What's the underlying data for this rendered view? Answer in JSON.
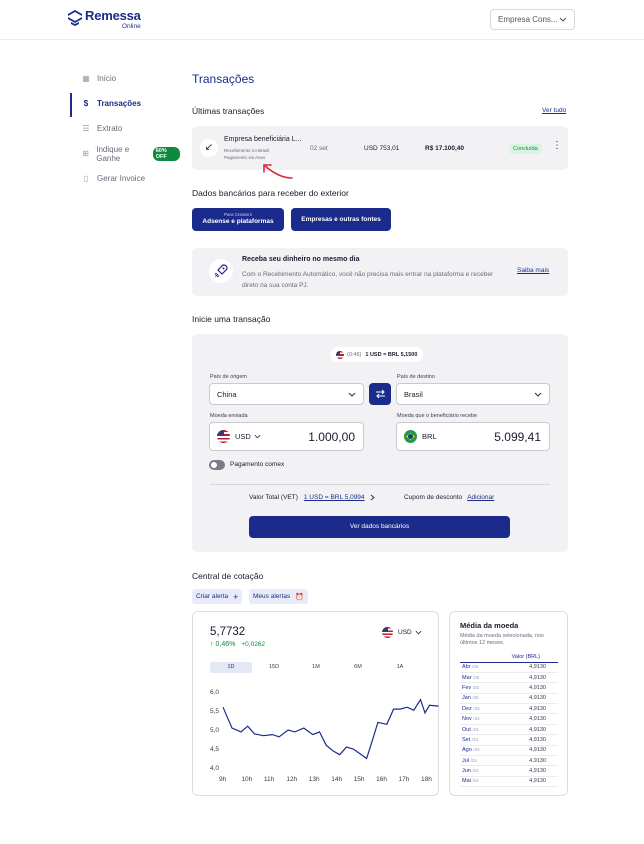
{
  "header": {
    "brand": "Remessa",
    "brand_sub": "Online",
    "company_select": "Empresa Cons..."
  },
  "sidebar": {
    "items": [
      {
        "label": "Início",
        "icon": "grid-icon"
      },
      {
        "label": "Transações",
        "icon": "dollar-icon",
        "active": true
      },
      {
        "label": "Extrato",
        "icon": "list-icon"
      },
      {
        "label": "Indique e Ganhe",
        "icon": "gift-icon",
        "badge": "60% OFF"
      },
      {
        "label": "Gerar Invoice",
        "icon": "document-icon"
      }
    ]
  },
  "page": {
    "title": "Transações"
  },
  "recent": {
    "title": "Últimas transações",
    "see_all": "Ver tudo",
    "row": {
      "name": "Empresa beneficiária L...",
      "sub1": "Recebimento no Brasil",
      "sub2": "Pagamento via Anex",
      "date": "02 set",
      "usd": "USD 753,01",
      "brl": "R$ 17.100,40",
      "status": "Concluída"
    }
  },
  "bank": {
    "title": "Dados bancários para receber do exterior",
    "btn1_small": "Para Creators",
    "btn1": "Adsense e plataformas",
    "btn2": "Empresas e outras fontes"
  },
  "promo": {
    "title": "Receba seu dinheiro no mesmo dia",
    "text": "Com o Recebimento Automático, você não precisa mais entrar na plataforma e receber direto na sua conta PJ.",
    "link": "Saiba mais"
  },
  "start": {
    "title": "Inicie uma transação",
    "timer": "(0:46)",
    "rate": "1 USD = BRL 5,1500",
    "origin_label": "País de origem",
    "origin_value": "China",
    "dest_label": "País de destino",
    "dest_value": "Brasil",
    "sent_label": "Moeda enviada",
    "sent_currency": "USD",
    "sent_amount": "1.000,00",
    "recv_label": "Moeda que o beneficiário recebe",
    "recv_currency": "BRL",
    "recv_amount": "5.099,41",
    "toggle_label": "Pagamento comex",
    "vet_label": "Valor Total (VET)",
    "vet_value": "1 USD = BRL 5,0994",
    "coupon_label": "Cupom de desconto",
    "coupon_link": "Adicionar",
    "cta": "Ver dados bancários"
  },
  "quote": {
    "title": "Central de cotação",
    "alert_btn": "Criar alerta",
    "my_alerts": "Meus alertas",
    "value": "5,7732",
    "change": "0,46%",
    "change_abs": "+0,0262",
    "currency": "USD",
    "periods": [
      "1D",
      "15D",
      "1M",
      "6M",
      "1A"
    ],
    "selected_period": "1D"
  },
  "chart_data": {
    "type": "line",
    "x": [
      "9h",
      "10h",
      "11h",
      "12h",
      "13h",
      "14h",
      "15h",
      "16h",
      "17h",
      "18h"
    ],
    "yticks": [
      "6,0",
      "5,5",
      "5,0",
      "4,5",
      "4,0"
    ],
    "ylim": [
      4.0,
      6.0
    ],
    "xlim": [
      9,
      18
    ],
    "points": [
      [
        9.0,
        5.6
      ],
      [
        9.4,
        5.05
      ],
      [
        9.8,
        4.95
      ],
      [
        10.1,
        5.1
      ],
      [
        10.4,
        4.9
      ],
      [
        10.8,
        4.85
      ],
      [
        11.2,
        4.88
      ],
      [
        11.5,
        4.82
      ],
      [
        11.9,
        5.0
      ],
      [
        12.2,
        4.95
      ],
      [
        12.6,
        5.05
      ],
      [
        13.0,
        4.88
      ],
      [
        13.3,
        4.95
      ],
      [
        13.6,
        4.6
      ],
      [
        13.9,
        4.45
      ],
      [
        14.2,
        4.35
      ],
      [
        14.5,
        4.55
      ],
      [
        14.8,
        4.5
      ],
      [
        15.1,
        4.38
      ],
      [
        15.4,
        4.25
      ],
      [
        15.6,
        4.62
      ],
      [
        15.9,
        5.2
      ],
      [
        16.3,
        5.15
      ],
      [
        16.6,
        5.55
      ],
      [
        16.9,
        5.55
      ],
      [
        17.2,
        5.6
      ],
      [
        17.5,
        5.52
      ],
      [
        17.8,
        5.8
      ],
      [
        18.0,
        5.45
      ],
      [
        18.2,
        5.65
      ],
      [
        18.6,
        5.63
      ]
    ]
  },
  "avg": {
    "title": "Média da moeda",
    "desc": "Média da moeda selecionada, nos últimos 12 meses.",
    "col": "Valor (BRL)",
    "rows": [
      {
        "m": "Abr",
        "y": "/25",
        "v": "4,9130"
      },
      {
        "m": "Mar",
        "y": "/25",
        "v": "4,9130"
      },
      {
        "m": "Fev",
        "y": "/25",
        "v": "4,9130"
      },
      {
        "m": "Jan",
        "y": "/25",
        "v": "4,9130"
      },
      {
        "m": "Dez",
        "y": "/24",
        "v": "4,9130"
      },
      {
        "m": "Nov",
        "y": "/24",
        "v": "4,9130"
      },
      {
        "m": "Out",
        "y": "/24",
        "v": "4,9130"
      },
      {
        "m": "Set",
        "y": "/24",
        "v": "4,9130"
      },
      {
        "m": "Ago",
        "y": "/24",
        "v": "4,9130"
      },
      {
        "m": "Jul",
        "y": "/24",
        "v": "4,9130"
      },
      {
        "m": "Jun",
        "y": "/24",
        "v": "4,9130"
      },
      {
        "m": "Mai",
        "y": "/24",
        "v": "4,9130"
      }
    ]
  },
  "colors": {
    "brand": "#1b2b8c",
    "success": "#0d8a3e",
    "annotation": "#e0283c"
  }
}
